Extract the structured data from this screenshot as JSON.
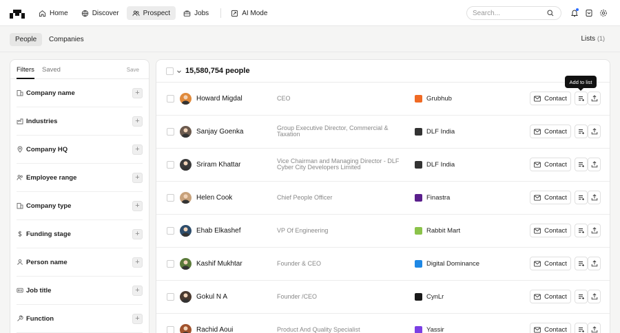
{
  "nav": {
    "items": [
      {
        "label": "Home",
        "icon": "home-icon"
      },
      {
        "label": "Discover",
        "icon": "globe-icon"
      },
      {
        "label": "Prospect",
        "icon": "users-icon",
        "active": true
      },
      {
        "label": "Jobs",
        "icon": "briefcase-icon"
      },
      {
        "label": "AI Mode",
        "icon": "ai-icon"
      }
    ],
    "search_placeholder": "Search..."
  },
  "subnav": {
    "tabs": [
      {
        "label": "People",
        "active": true
      },
      {
        "label": "Companies"
      }
    ],
    "lists_label": "Lists",
    "lists_count": "(1)"
  },
  "filters": {
    "tabs": [
      "Filters",
      "Saved"
    ],
    "save_label": "Save",
    "items": [
      {
        "label": "Company name",
        "icon": "building-icon"
      },
      {
        "label": "Industries",
        "icon": "factory-icon"
      },
      {
        "label": "Company HQ",
        "icon": "location-pin-icon"
      },
      {
        "label": "Employee range",
        "icon": "people-icon"
      },
      {
        "label": "Company type",
        "icon": "building-icon"
      },
      {
        "label": "Funding stage",
        "icon": "dollar-icon"
      },
      {
        "label": "Person name",
        "icon": "person-icon"
      },
      {
        "label": "Job title",
        "icon": "id-badge-icon"
      },
      {
        "label": "Function",
        "icon": "wrench-icon"
      }
    ]
  },
  "results": {
    "count_label": "15,580,754 people",
    "contact_label": "Contact",
    "tooltip": "Add to list",
    "rows": [
      {
        "name": "Howard Migdal",
        "title": "CEO",
        "company": "Grubhub",
        "logo_color": "#f06a24",
        "avatar_color": "#e08a3c"
      },
      {
        "name": "Sanjay Goenka",
        "title": "Group Executive Director, Commercial & Taxation",
        "company": "DLF India",
        "logo_color": "#333333",
        "avatar_color": "#6b5a4e"
      },
      {
        "name": "Sriram Khattar",
        "title": "Vice Chairman and Managing Director - DLF Cyber City Developers Limited",
        "company": "DLF India",
        "logo_color": "#333333",
        "avatar_color": "#3b3b3b"
      },
      {
        "name": "Helen Cook",
        "title": "Chief People Officer",
        "company": "Finastra",
        "logo_color": "#5a1f8c",
        "avatar_color": "#c8a27c"
      },
      {
        "name": "Ehab Elkashef",
        "title": "VP Of Engineering",
        "company": "Rabbit Mart",
        "logo_color": "#8bc34a",
        "avatar_color": "#2e4d6b"
      },
      {
        "name": "Kashif Mukhtar",
        "title": "Founder & CEO",
        "company": "Digital Dominance",
        "logo_color": "#1e88e5",
        "avatar_color": "#5b7a3a"
      },
      {
        "name": "Gokul N A",
        "title": "Founder /CEO",
        "company": "CynLr",
        "logo_color": "#1a1a1a",
        "avatar_color": "#4a3a30"
      },
      {
        "name": "Rachid Aoui",
        "title": "Product And Quality Specialist",
        "company": "Yassir",
        "logo_color": "#7b3fe4",
        "avatar_color": "#a0522d"
      }
    ]
  }
}
